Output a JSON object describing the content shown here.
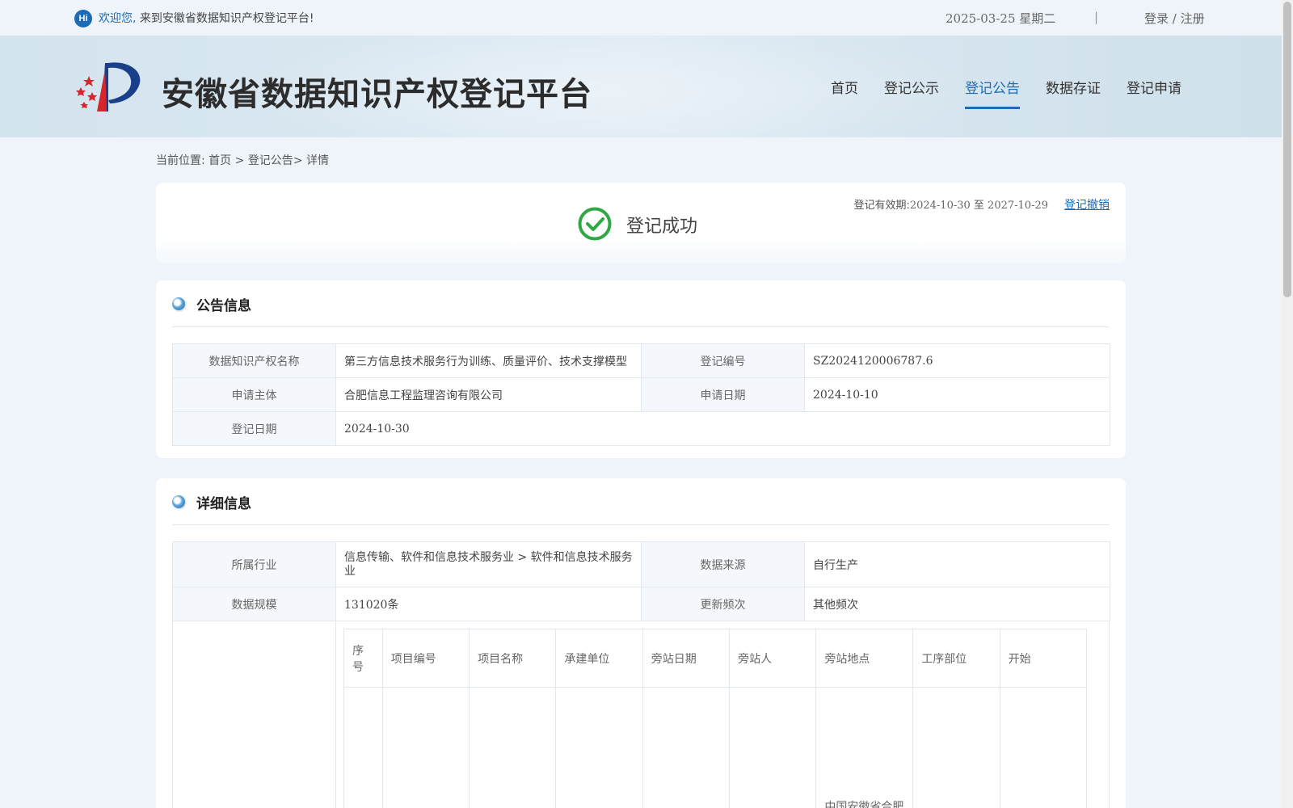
{
  "topbar": {
    "hi": "Hi",
    "welcome_highlight": "欢迎您,",
    "welcome_rest": " 来到安徽省数据知识产权登记平台!",
    "date": "2025-03-25 星期二",
    "separator": "|",
    "login": "登录",
    "auth_sep": " / ",
    "register": "注册"
  },
  "header": {
    "site_title": "安徽省数据知识产权登记平台",
    "nav": [
      {
        "label": "首页"
      },
      {
        "label": "登记公示"
      },
      {
        "label": "登记公告"
      },
      {
        "label": "数据存证"
      },
      {
        "label": "登记申请"
      }
    ],
    "active_nav": "登记公告"
  },
  "breadcrumb": {
    "prefix": "当前位置:",
    "home": "首页",
    "sep1": " > ",
    "section": "登记公告",
    "sep2": "> ",
    "current": "详情"
  },
  "status": {
    "text": "登记成功",
    "validity_label": "登记有效期:",
    "validity_start": "2024-10-30",
    "validity_to": " 至 ",
    "validity_end": "2027-10-29",
    "revoke": "登记撤销",
    "check_color": "#2ea843"
  },
  "announcement": {
    "title": "公告信息",
    "name_label": "数据知识产权名称",
    "name_value": "第三方信息技术服务行为训练、质量评价、技术支撑模型",
    "reg_no_label": "登记编号",
    "reg_no_value": "SZ2024120006787.6",
    "applicant_label": "申请主体",
    "applicant_value": "合肥信息工程监理咨询有限公司",
    "apply_date_label": "申请日期",
    "apply_date_value": "2024-10-10",
    "reg_date_label": "登记日期",
    "reg_date_value": "2024-10-30"
  },
  "details": {
    "title": "详细信息",
    "industry_label": "所属行业",
    "industry_value": "信息传输、软件和信息技术服务业 > 软件和信息技术服务业",
    "source_label": "数据来源",
    "source_value": "自行生产",
    "scale_label": "数据规模",
    "scale_value": "131020条",
    "freq_label": "更新频次",
    "freq_value": "其他频次",
    "columns": [
      "序号",
      "项目编号",
      "项目名称",
      "承建单位",
      "旁站日期",
      "旁站人",
      "旁站地点",
      "工序部位",
      "开始"
    ],
    "partial_cell": "中国安徽省合肥"
  },
  "colors": {
    "accent": "#1c6bb5",
    "background": "#eef4f9"
  }
}
